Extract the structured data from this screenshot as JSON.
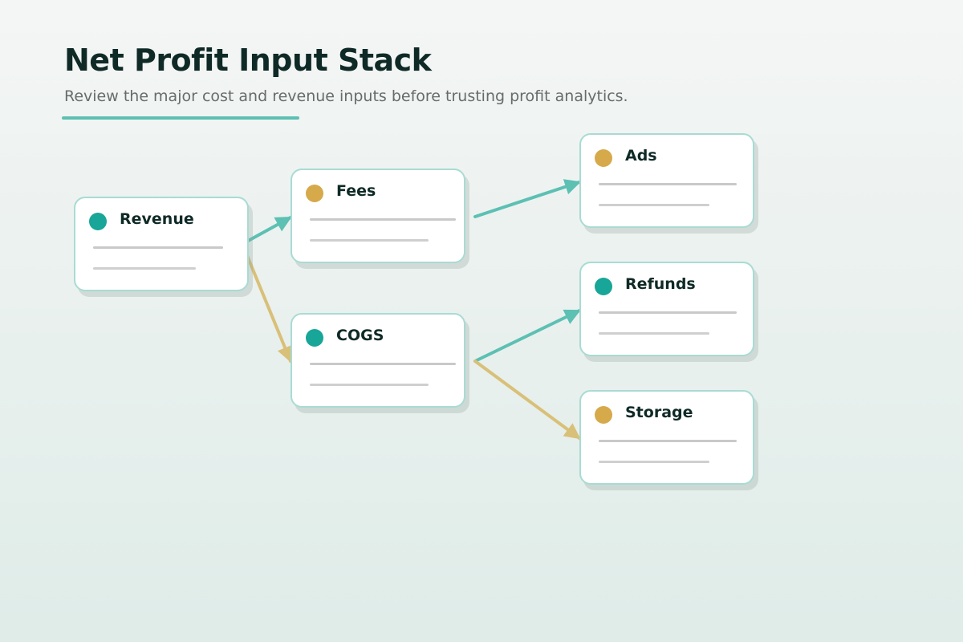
{
  "header": {
    "title": "Net Profit Input Stack",
    "subtitle": "Review the major cost and revenue inputs before trusting profit analytics."
  },
  "colors": {
    "teal": "#17a697",
    "gold": "#d6a94a",
    "edge_teal": "#5cc0b3",
    "edge_gold": "#d9c078"
  },
  "nodes": [
    {
      "id": "revenue",
      "label": "Revenue",
      "dot_color": "teal"
    },
    {
      "id": "fees",
      "label": "Fees",
      "dot_color": "gold"
    },
    {
      "id": "cogs",
      "label": "COGS",
      "dot_color": "teal"
    },
    {
      "id": "ads",
      "label": "Ads",
      "dot_color": "gold"
    },
    {
      "id": "refunds",
      "label": "Refunds",
      "dot_color": "teal"
    },
    {
      "id": "storage",
      "label": "Storage",
      "dot_color": "gold"
    }
  ],
  "edges": [
    {
      "from": "revenue",
      "to": "fees",
      "color": "teal"
    },
    {
      "from": "revenue",
      "to": "cogs",
      "color": "gold"
    },
    {
      "from": "fees",
      "to": "ads",
      "color": "teal"
    },
    {
      "from": "cogs",
      "to": "refunds",
      "color": "teal"
    },
    {
      "from": "cogs",
      "to": "storage",
      "color": "gold"
    }
  ]
}
